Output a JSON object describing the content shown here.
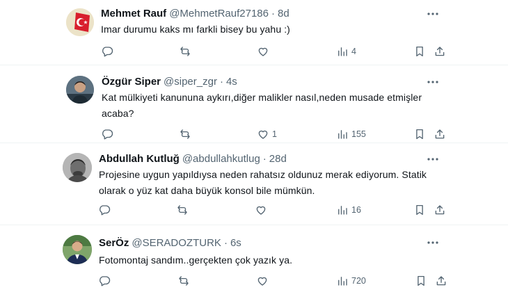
{
  "posts": [
    {
      "name": "Mehmet Rauf",
      "handle": "@MehmetRauf27186",
      "time": "8d",
      "lines": [
        "Imar durumu kaks mı farkli bisey bu yahu :)"
      ],
      "reply_count": "",
      "repost_count": "",
      "like_count": "",
      "views": "4",
      "avatar": "turkish-flag-avatar"
    },
    {
      "name": "Özgür Siper",
      "handle": "@siper_zgr",
      "time": "4s",
      "lines": [
        "Kat mülkiyeti kanununa aykırı,diğer malikler nasıl,neden musade etmişler",
        "acaba?"
      ],
      "reply_count": "",
      "repost_count": "",
      "like_count": "1",
      "views": "155",
      "avatar": "photo-avatar"
    },
    {
      "name": "Abdullah Kutluğ",
      "handle": "@abdullahkutlug",
      "time": "28d",
      "lines": [
        "Projesine uygun yapıldıysa neden rahatsız oldunuz merak ediyorum. Statik",
        "olarak o yüz kat daha büyük konsol bile mümkün."
      ],
      "reply_count": "",
      "repost_count": "",
      "like_count": "",
      "views": "16",
      "avatar": "grayscale-photo-avatar"
    },
    {
      "name": "SerÖz",
      "handle": "@SERADOZTURK",
      "time": "6s",
      "lines": [
        "Fotomontaj sandım..gerçekten çok yazık ya."
      ],
      "reply_count": "",
      "repost_count": "",
      "like_count": "",
      "views": "720",
      "avatar": "photo-avatar-suit"
    }
  ],
  "separator": "·",
  "icons": {
    "more": "more-dots-icon",
    "reply": "reply-bubble-icon",
    "repost": "repost-arrows-icon",
    "like": "heart-icon",
    "views": "views-bars-icon",
    "bookmark": "bookmark-icon",
    "share": "share-arrow-icon"
  },
  "colors": {
    "text": "#0f1419",
    "secondary": "#536471",
    "divider": "#eff3f4"
  }
}
